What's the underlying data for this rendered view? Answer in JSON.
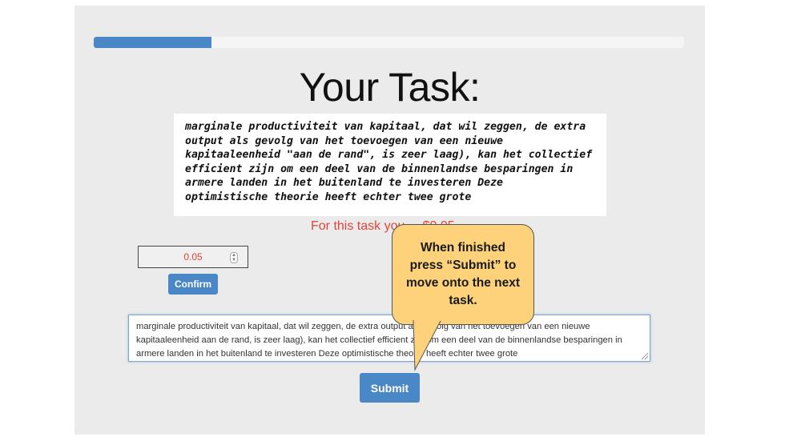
{
  "progress": {
    "fraction": 0.2
  },
  "task": {
    "title": "Your Task:",
    "image_text": "marginale productiviteit van kapitaal, dat wil zeggen, de extra output als gevolg van het toevoegen van een nieuwe kapitaaleenheid \"aan de rand\", is zeer laag), kan het collectief efficient zijn om een deel van de binnenlandse besparingen in armere landen in het buitenland te investeren Deze optimistische theorie heeft echter twee grote",
    "image_lines": [
      "marginale productiviteit van kapitaal, dat wil zeggen, de extra",
      "output als gevolg van het toevoegen van een nieuwe",
      "kapitaaleenheid \"aan de rand\", is zeer laag), kan het collectief",
      "efficient zijn om een deel van de binnenlandse besparingen in",
      "armere landen in het buitenland te investeren Deze",
      "optimistische theorie heeft echter twee grote"
    ],
    "reward_text": "For this task you ... $0.05"
  },
  "bid": {
    "value": "0.05",
    "confirm_label": "Confirm"
  },
  "answer": {
    "value": "marginale productiviteit van kapitaal, dat wil zeggen, de extra output als gevolg van het toevoegen van een nieuwe kapitaaleenheid aan de rand, is zeer laag), kan het collectief efficient zijn om een deel van de binnenlandse besparingen in armere landen in het buitenland te investeren Deze optimistische theorie heeft echter twee grote"
  },
  "submit_label": "Submit",
  "callout": {
    "lines": [
      "When finished",
      "press “Submit” to",
      "move onto the next",
      "task."
    ]
  },
  "colors": {
    "accent": "#4a87c7",
    "reward": "#e0443b",
    "callout": "#fdd27a",
    "panel": "#ebebeb"
  }
}
